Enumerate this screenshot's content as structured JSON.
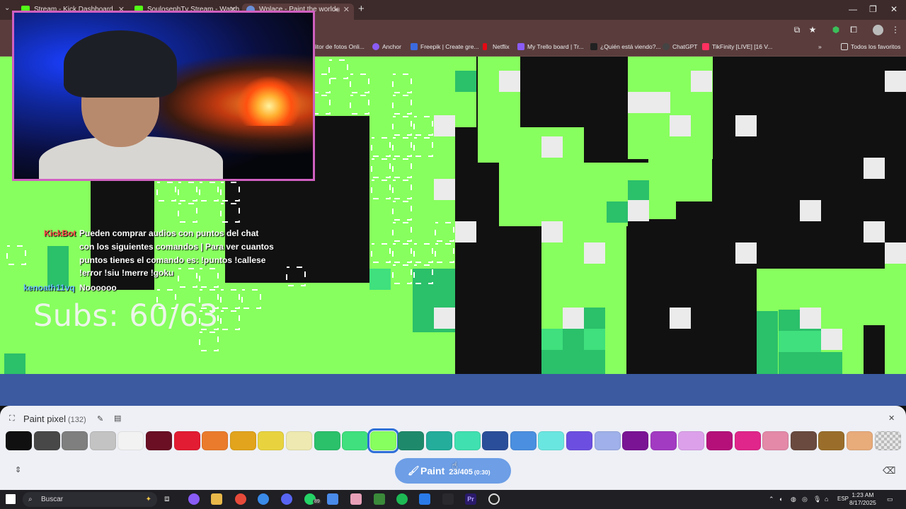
{
  "browser": {
    "tabs": [
      {
        "title": "Stream - Kick Dashboard",
        "color": "#53fc18"
      },
      {
        "title": "SoulosephTv Stream - Watch L",
        "color": "#53fc18"
      },
      {
        "title": "Wplace - Paint the world",
        "color": "#6a8fd8"
      }
    ],
    "window_controls": [
      "—",
      "❐",
      "✕"
    ]
  },
  "bookmarks": [
    {
      "label": "litor de fotos Onli...",
      "color": "#d0a060"
    },
    {
      "label": "Anchor",
      "color": "#8a5cf6"
    },
    {
      "label": "Freepik | Create gre...",
      "color": "#3b6ae0"
    },
    {
      "label": "Netflix",
      "color": "#e50914"
    },
    {
      "label": "My Trello board | Tr...",
      "color": "#8a5cf6"
    },
    {
      "label": "¿Quién está viendo?...",
      "color": "#222222"
    },
    {
      "label": "ChatGPT",
      "color": "#444444"
    },
    {
      "label": "TikFinity [LIVE] [16 V...",
      "color": "#ff3060"
    }
  ],
  "bookmarks_all": "Todos los favoritos",
  "chat": [
    {
      "user": "KickBot",
      "user_color": "#ff4a4a",
      "lines": [
        "Pueden comprar audios con puntos del chat",
        "con los siguientes comandos | Para ver cuantos",
        "puntos tienes el comando es: !puntos !callese",
        "!error !siu !merre !goku"
      ]
    },
    {
      "user": "kenoath11vq",
      "user_color": "#6ac4ff",
      "lines": [
        "Noooooo"
      ]
    }
  ],
  "subs_text": "Subs: 60/63",
  "panel": {
    "title": "Paint pixel",
    "count": "(132)",
    "palette": [
      "#101010",
      "#484848",
      "#7f7f7f",
      "#c3c3c3",
      "#f2f2f2",
      "#6a0f24",
      "#e21c32",
      "#ea7b2c",
      "#e2a41c",
      "#e8d33f",
      "#ede9b0",
      "#2bc06a",
      "#3fe07d",
      "#87ff5e",
      "#1f8a6b",
      "#23ad9a",
      "#40e0b0",
      "#2b4e9a",
      "#4a8fe0",
      "#6ae6e0",
      "#6c4fe0",
      "#9fb0ea",
      "#7a1494",
      "#a23bc2",
      "#dca0ea",
      "#b5107a",
      "#e0268a",
      "#e489a8",
      "#6a4a3f",
      "#9a6e2a",
      "#e8ab7a",
      "transparent"
    ],
    "selected_index": 13,
    "paint_label": "Paint",
    "paint_count": "23/405",
    "paint_timer": "(0:30)"
  },
  "taskbar": {
    "search_placeholder": "Buscar",
    "whatsapp_badge": "89",
    "language": "ESP",
    "time": "1:23 AM",
    "date": "8/17/2025"
  },
  "colors": {
    "pixel_green": "#87ff5e",
    "pixel_dark_green": "#2bc06a",
    "pixel_mid_green": "#3fe07d",
    "pixel_white": "#ebebeb",
    "background": "#111111",
    "sea_blue": "#3b5aa0"
  }
}
